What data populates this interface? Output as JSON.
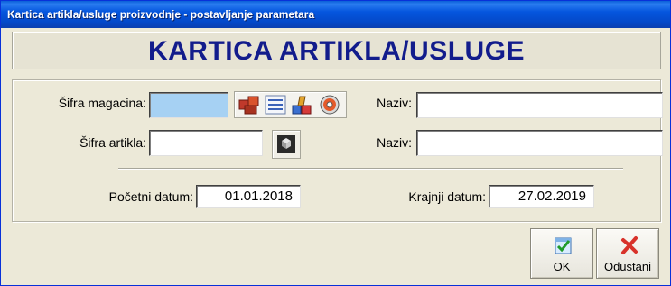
{
  "window": {
    "title": "Kartica artikla/usluge proizvodnje - postavljanje parametara"
  },
  "header": {
    "heading": "KARTICA ARTIKLA/USLUGE"
  },
  "form": {
    "sifra_magacina_label": "Šifra magacina:",
    "sifra_magacina_value": "",
    "naziv_label_1": "Naziv:",
    "naziv_value_1": "",
    "sifra_artikla_label": "Šifra artikla:",
    "sifra_artikla_value": "",
    "naziv_label_2": "Naziv:",
    "naziv_value_2": "",
    "pocetni_datum_label": "Početni datum:",
    "pocetni_datum_value": "01.01.2018",
    "krajnji_datum_label": "Krajnji datum:",
    "krajnji_datum_value": "27.02.2019"
  },
  "buttons": {
    "ok_label": "OK",
    "cancel_label": "Odustani"
  },
  "icons": {
    "warehouse_1": "boxes-red-icon",
    "warehouse_2": "document-list-icon",
    "warehouse_3": "products-icon",
    "warehouse_4": "disc-icon",
    "article": "cubes-icon",
    "ok": "checkmark-icon",
    "cancel": "red-x-icon"
  },
  "colors": {
    "title_bar": "#0556de",
    "heading": "#121c8c",
    "active_field": "#a6d1f3"
  }
}
